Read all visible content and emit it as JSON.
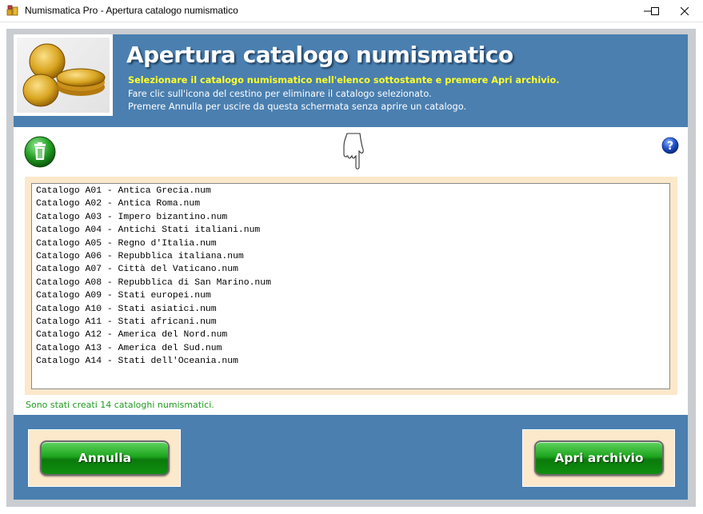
{
  "window": {
    "title": "Numismatica Pro - Apertura catalogo numismatico",
    "icons": {
      "app": "coins-icon",
      "minimize": "minimize-icon",
      "maximize": "maximize-icon",
      "close": "close-icon"
    }
  },
  "header": {
    "title": "Apertura catalogo numismatico",
    "line1": "Selezionare il catalogo numismatico nell'elenco sottostante e premere Apri archivio.",
    "line2": "Fare clic sull'icona del cestino per eliminare il catalogo selezionato.",
    "line3": "Premere Annulla per uscire da questa schermata senza aprire un catalogo.",
    "colors": {
      "background": "#4a7fb0",
      "highlight": "#ffff2a"
    }
  },
  "toolbar": {
    "delete_icon": "trash-icon",
    "pointer_icon": "pointing-hand-icon",
    "help_icon": "help-icon"
  },
  "catalogs": [
    "Catalogo A01 - Antica Grecia.num",
    "Catalogo A02 - Antica Roma.num",
    "Catalogo A03 - Impero bizantino.num",
    "Catalogo A04 - Antichi Stati italiani.num",
    "Catalogo A05 - Regno d'Italia.num",
    "Catalogo A06 - Repubblica italiana.num",
    "Catalogo A07 - Città del Vaticano.num",
    "Catalogo A08 - Repubblica di San Marino.num",
    "Catalogo A09 - Stati europei.num",
    "Catalogo A10 - Stati asiatici.num",
    "Catalogo A11 - Stati africani.num",
    "Catalogo A12 - America del Nord.num",
    "Catalogo A13 - America del Sud.num",
    "Catalogo A14 - Stati dell'Oceania.num"
  ],
  "status": "Sono stati creati 14 cataloghi numismatici.",
  "buttons": {
    "cancel": "Annulla",
    "open": "Apri archivio"
  },
  "colors": {
    "status_text": "#1f9a1f",
    "button_green": "#1ea51e",
    "panel_beige": "#fce8cb"
  }
}
